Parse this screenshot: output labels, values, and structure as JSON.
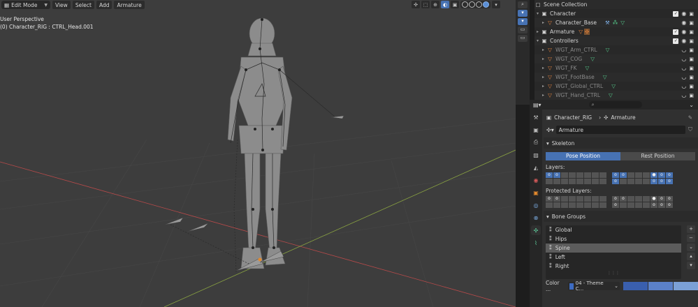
{
  "viewport": {
    "mode": "Edit Mode",
    "menus": [
      "View",
      "Select",
      "Add",
      "Armature"
    ],
    "info_line1": "User Perspective",
    "info_line2": "(0) Character_RIG : CTRL_Head.001"
  },
  "outliner": {
    "header": "Scene Collection",
    "rows": [
      {
        "label": "Character",
        "level": 0,
        "icon": "collection-icon"
      },
      {
        "label": "Character_Base",
        "level": 1,
        "icon": "mesh-icon"
      },
      {
        "label": "Armature",
        "level": 0,
        "icon": "collection-icon"
      },
      {
        "label": "Controllers",
        "level": 0,
        "icon": "collection-icon"
      },
      {
        "label": "WGT_Arm_CTRL",
        "level": 1,
        "icon": "mesh-icon"
      },
      {
        "label": "WGT_COG",
        "level": 1,
        "icon": "mesh-icon"
      },
      {
        "label": "WGT_FK",
        "level": 1,
        "icon": "mesh-icon"
      },
      {
        "label": "WGT_FootBase",
        "level": 1,
        "icon": "mesh-icon"
      },
      {
        "label": "WGT_Global_CTRL",
        "level": 1,
        "icon": "mesh-icon"
      },
      {
        "label": "WGT_Hand_CTRL",
        "level": 1,
        "icon": "mesh-icon"
      }
    ]
  },
  "properties": {
    "context_object": "Character_RIG",
    "context_data": "Armature",
    "data_name": "Armature",
    "skeleton_panel": "Skeleton",
    "pose_position": "Pose Position",
    "rest_position": "Rest Position",
    "layers_label": "Layers:",
    "protected_layers_label": "Protected Layers:",
    "bone_groups_panel": "Bone Groups",
    "bone_groups": [
      "Global",
      "Hips",
      "Spine",
      "Left",
      "Right"
    ],
    "selected_group": "Spine",
    "color_label": "Color ...",
    "color_set": "04 - Theme C...",
    "swatch_colors": [
      "#3a5fae",
      "#5b81c9",
      "#7ba0d6"
    ]
  }
}
